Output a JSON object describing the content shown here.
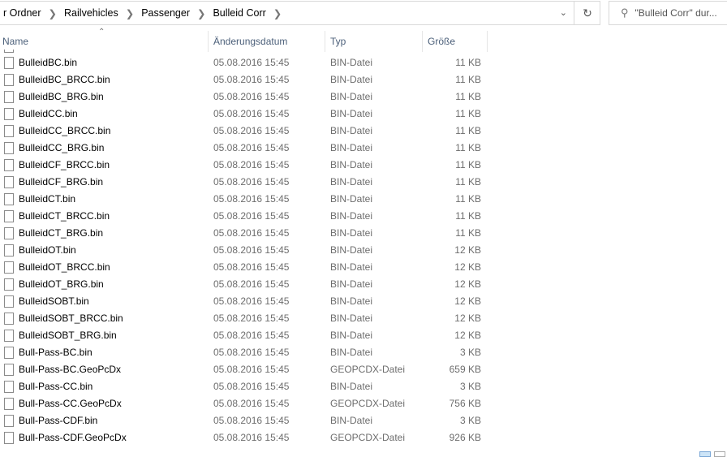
{
  "breadcrumb": [
    "r Ordner",
    "Railvehicles",
    "Passenger",
    "Bulleid Corr"
  ],
  "search": {
    "placeholder": "\"Bulleid Corr\" dur..."
  },
  "columns": {
    "name": "Name",
    "date": "Änderungsdatum",
    "type": "Typ",
    "size": "Größe"
  },
  "files": [
    {
      "name": "BulleidBC.bin",
      "date": "05.08.2016 15:45",
      "type": "BIN-Datei",
      "size": "11 KB"
    },
    {
      "name": "BulleidBC_BRCC.bin",
      "date": "05.08.2016 15:45",
      "type": "BIN-Datei",
      "size": "11 KB"
    },
    {
      "name": "BulleidBC_BRG.bin",
      "date": "05.08.2016 15:45",
      "type": "BIN-Datei",
      "size": "11 KB"
    },
    {
      "name": "BulleidCC.bin",
      "date": "05.08.2016 15:45",
      "type": "BIN-Datei",
      "size": "11 KB"
    },
    {
      "name": "BulleidCC_BRCC.bin",
      "date": "05.08.2016 15:45",
      "type": "BIN-Datei",
      "size": "11 KB"
    },
    {
      "name": "BulleidCC_BRG.bin",
      "date": "05.08.2016 15:45",
      "type": "BIN-Datei",
      "size": "11 KB"
    },
    {
      "name": "BulleidCF_BRCC.bin",
      "date": "05.08.2016 15:45",
      "type": "BIN-Datei",
      "size": "11 KB"
    },
    {
      "name": "BulleidCF_BRG.bin",
      "date": "05.08.2016 15:45",
      "type": "BIN-Datei",
      "size": "11 KB"
    },
    {
      "name": "BulleidCT.bin",
      "date": "05.08.2016 15:45",
      "type": "BIN-Datei",
      "size": "11 KB"
    },
    {
      "name": "BulleidCT_BRCC.bin",
      "date": "05.08.2016 15:45",
      "type": "BIN-Datei",
      "size": "11 KB"
    },
    {
      "name": "BulleidCT_BRG.bin",
      "date": "05.08.2016 15:45",
      "type": "BIN-Datei",
      "size": "11 KB"
    },
    {
      "name": "BulleidOT.bin",
      "date": "05.08.2016 15:45",
      "type": "BIN-Datei",
      "size": "12 KB"
    },
    {
      "name": "BulleidOT_BRCC.bin",
      "date": "05.08.2016 15:45",
      "type": "BIN-Datei",
      "size": "12 KB"
    },
    {
      "name": "BulleidOT_BRG.bin",
      "date": "05.08.2016 15:45",
      "type": "BIN-Datei",
      "size": "12 KB"
    },
    {
      "name": "BulleidSOBT.bin",
      "date": "05.08.2016 15:45",
      "type": "BIN-Datei",
      "size": "12 KB"
    },
    {
      "name": "BulleidSOBT_BRCC.bin",
      "date": "05.08.2016 15:45",
      "type": "BIN-Datei",
      "size": "12 KB"
    },
    {
      "name": "BulleidSOBT_BRG.bin",
      "date": "05.08.2016 15:45",
      "type": "BIN-Datei",
      "size": "12 KB"
    },
    {
      "name": "Bull-Pass-BC.bin",
      "date": "05.08.2016 15:45",
      "type": "BIN-Datei",
      "size": "3 KB"
    },
    {
      "name": "Bull-Pass-BC.GeoPcDx",
      "date": "05.08.2016 15:45",
      "type": "GEOPCDX-Datei",
      "size": "659 KB"
    },
    {
      "name": "Bull-Pass-CC.bin",
      "date": "05.08.2016 15:45",
      "type": "BIN-Datei",
      "size": "3 KB"
    },
    {
      "name": "Bull-Pass-CC.GeoPcDx",
      "date": "05.08.2016 15:45",
      "type": "GEOPCDX-Datei",
      "size": "756 KB"
    },
    {
      "name": "Bull-Pass-CDF.bin",
      "date": "05.08.2016 15:45",
      "type": "BIN-Datei",
      "size": "3 KB"
    },
    {
      "name": "Bull-Pass-CDF.GeoPcDx",
      "date": "05.08.2016 15:45",
      "type": "GEOPCDX-Datei",
      "size": "926 KB"
    }
  ]
}
